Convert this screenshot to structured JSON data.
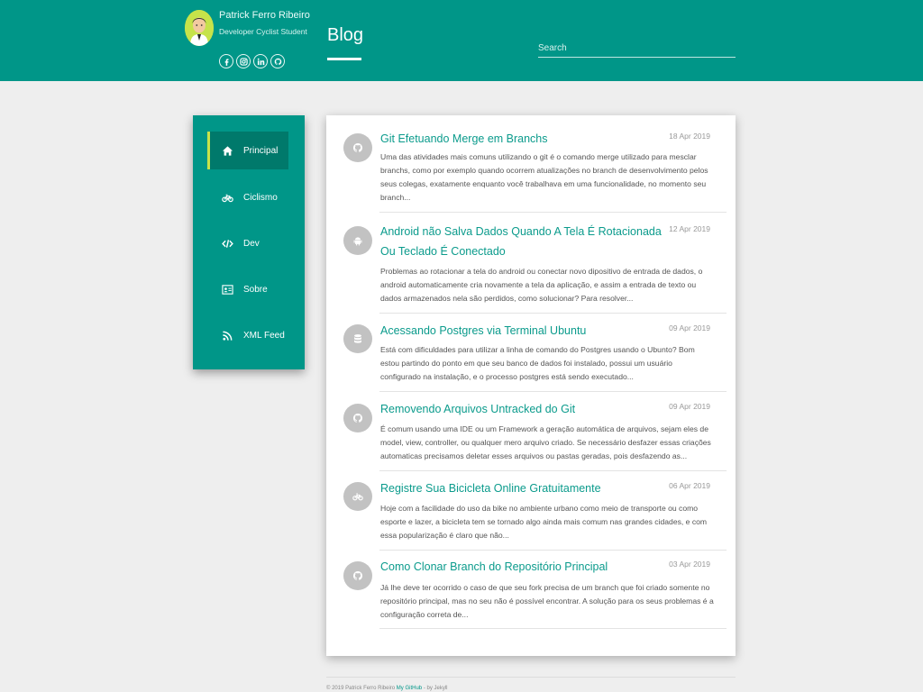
{
  "profile": {
    "name": "Patrick Ferro Ribeiro",
    "tagline": "Developer Cyclist Student",
    "socials": [
      "facebook-icon",
      "instagram-icon",
      "linkedin-icon",
      "github-icon"
    ]
  },
  "header": {
    "title": "Blog",
    "search_placeholder": "Search"
  },
  "nav": [
    {
      "label": "Principal",
      "icon": "home-icon",
      "active": true
    },
    {
      "label": "Ciclismo",
      "icon": "bicycle-icon",
      "active": false
    },
    {
      "label": "Dev",
      "icon": "code-icon",
      "active": false
    },
    {
      "label": "Sobre",
      "icon": "id-card-icon",
      "active": false
    },
    {
      "label": "XML Feed",
      "icon": "rss-icon",
      "active": false
    }
  ],
  "posts": [
    {
      "title": "Git Efetuando Merge em Branchs",
      "date": "18 Apr 2019",
      "icon": "github-icon",
      "excerpt": "Uma das atividades mais comuns utilizando o git é o comando merge utilizado para mesclar branchs, como por exemplo quando ocorrem atualizações no branch de desenvolvimento pelos seus colegas, exatamente enquanto você trabalhava em uma funcionalidade, no momento seu branch..."
    },
    {
      "title": "Android não Salva Dados Quando A Tela É Rotacionada Ou Teclado É Conectado",
      "date": "12 Apr 2019",
      "icon": "android-icon",
      "excerpt": "Problemas ao rotacionar a tela do android ou conectar novo dipositivo de entrada de dados, o android automaticamente cria novamente a tela da aplicação, e assim a entrada de texto ou dados armazenados nela são perdidos, como solucionar? Para resolver..."
    },
    {
      "title": "Acessando Postgres via Terminal Ubuntu",
      "date": "09 Apr 2019",
      "icon": "database-icon",
      "excerpt": "Está com dificuldades para utilizar a linha de comando do Postgres usando o Ubunto? Bom estou partindo do ponto em que seu banco de dados foi instalado, possui um usuário configurado na instalação, e o processo postgres está sendo executado..."
    },
    {
      "title": "Removendo Arquivos Untracked do Git",
      "date": "09 Apr 2019",
      "icon": "github-icon",
      "excerpt": "É comum usando uma IDE ou um Framework a geração automática de arquivos, sejam eles de model, view, controller, ou qualquer mero arquivo criado. Se necessário desfazer essas criações automaticas precisamos deletar esses arquivos ou pastas geradas, pois desfazendo as..."
    },
    {
      "title": "Registre Sua Bicicleta Online Gratuitamente",
      "date": "06 Apr 2019",
      "icon": "bicycle-icon",
      "excerpt": "Hoje com a facilidade do uso da bike no ambiente urbano como meio de transporte ou como esporte e lazer, a bicicleta tem se tornado algo ainda mais comum nas grandes cidades, e com essa popularização é claro que não..."
    },
    {
      "title": "Como Clonar Branch do Repositório Principal",
      "date": "03 Apr 2019",
      "icon": "github-icon",
      "excerpt": "Já lhe deve ter ocorrido o caso de que seu fork precisa de um branch que foi criado somente no repositório principal, mas no seu não é possível encontrar. A solução para os seus problemas é a configuração correta de..."
    }
  ],
  "footer": {
    "prefix": "© 2019 Patrick Ferro Ribeiro",
    "link": "My GitHub",
    "suffix": "- by Jekyll"
  },
  "colors": {
    "primary": "#009688",
    "primary_dark": "#00796b",
    "accent": "#c6e34a",
    "link": "#0b9b8c",
    "background": "#eeeeee"
  }
}
